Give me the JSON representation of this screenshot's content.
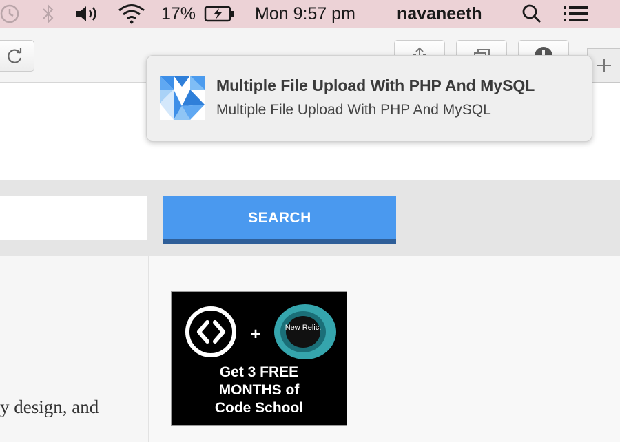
{
  "menubar": {
    "icons": [
      "time-machine-icon",
      "bluetooth-icon",
      "volume-icon",
      "wifi-icon",
      "battery-charging-icon",
      "spotlight-search-icon",
      "notification-center-icon"
    ],
    "battery_percent": "17%",
    "clock": "Mon 9:57 pm",
    "user_name": "navaneeth"
  },
  "toolbar": {
    "buttons": [
      "reload-icon",
      "share-icon",
      "tabs-icon",
      "info-icon",
      "new-tab-icon"
    ]
  },
  "search": {
    "placeholder": "",
    "button_label": "SEARCH"
  },
  "content": {
    "body_snippet": "y design, and"
  },
  "ad": {
    "logo_label": "New Relic.",
    "plus": "+",
    "line1": "Get 3 FREE",
    "line2": "MONTHS of",
    "line3": "Code School",
    "colors": {
      "background": "#000000",
      "relic": "#35a5ad"
    }
  },
  "notification": {
    "app_icon": "tuts-plus-logo-icon",
    "title": "Multiple File Upload With PHP And MySQL",
    "body": "Multiple File Upload With PHP And MySQL"
  },
  "colors": {
    "menubar": "#ecd2d6",
    "search_button": "#4a99ef",
    "search_button_shadow": "#2f5f99"
  }
}
